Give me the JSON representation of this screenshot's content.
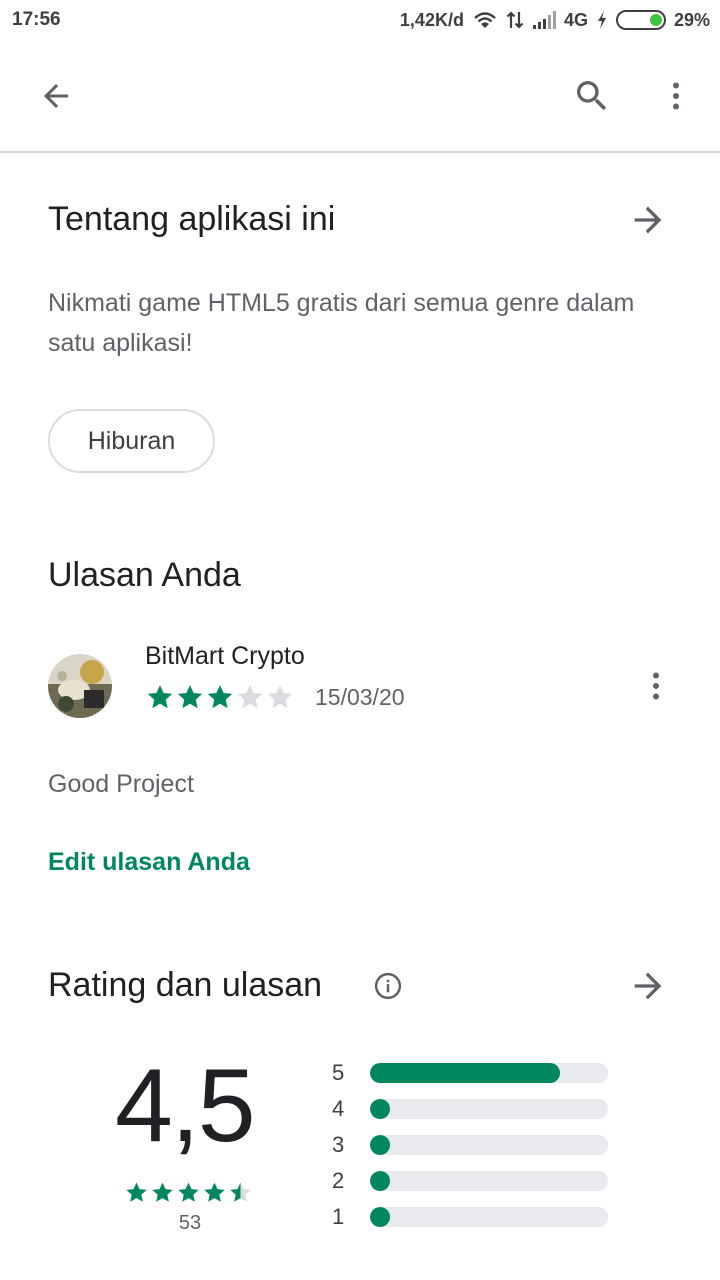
{
  "status_bar": {
    "time": "17:56",
    "network_speed": "1,42K/d",
    "network_type": "4G",
    "battery_percent": "29%",
    "battery_level": 0.29,
    "icons": [
      "wifi-icon",
      "data-transfer-icon",
      "signal-icon",
      "charging-icon",
      "battery-icon"
    ]
  },
  "app_bar": {
    "icons": [
      "back-arrow-icon",
      "search-icon",
      "more-vert-icon"
    ]
  },
  "about": {
    "title": "Tentang aplikasi ini",
    "description": "Nikmati game HTML5 gratis dari semua genre dalam satu aplikasi!",
    "category_chip": "Hiburan"
  },
  "your_review": {
    "title": "Ulasan Anda",
    "reviewer_name": "BitMart Crypto",
    "stars": 3,
    "max_stars": 5,
    "date": "15/03/20",
    "text": "Good Project",
    "edit_label": "Edit ulasan Anda"
  },
  "ratings": {
    "title": "Rating dan ulasan",
    "average": "4,5",
    "average_value": 4.5,
    "count": "53",
    "histogram": [
      {
        "label": "5",
        "fraction": 0.8
      },
      {
        "label": "4",
        "fraction": 0.05
      },
      {
        "label": "3",
        "fraction": 0.05
      },
      {
        "label": "2",
        "fraction": 0.05
      },
      {
        "label": "1",
        "fraction": 0.05
      }
    ]
  },
  "colors": {
    "accent_green": "#01875f",
    "star_empty": "#dadce0",
    "track": "#e8eaed"
  }
}
